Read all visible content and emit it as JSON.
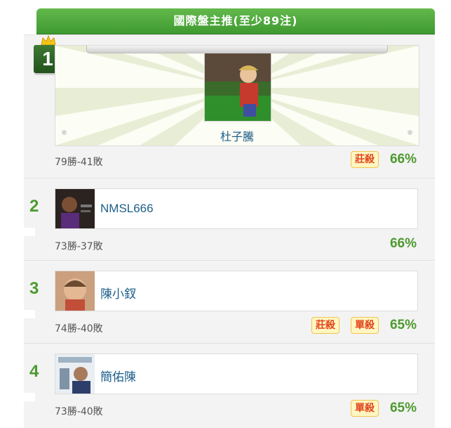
{
  "header": {
    "title": "國際盤主推(至少89注)"
  },
  "ranking": [
    {
      "rank": "1",
      "name": "杜子騰",
      "record": "79勝-41敗",
      "badges": [
        "莊殺"
      ],
      "percent": "66%"
    },
    {
      "rank": "2",
      "name": "NMSL666",
      "record": "73勝-37敗",
      "badges": [],
      "percent": "66%"
    },
    {
      "rank": "3",
      "name": "陳小釵",
      "record": "74勝-40敗",
      "badges": [
        "莊殺",
        "單殺"
      ],
      "percent": "65%"
    },
    {
      "rank": "4",
      "name": "簡佑陳",
      "record": "73勝-40敗",
      "badges": [
        "單殺"
      ],
      "percent": "65%"
    }
  ],
  "colors": {
    "header_green": "#4aa838",
    "rank_green": "#4d9a30",
    "badge_bg": "#fff6c2",
    "badge_text": "#e2461c",
    "name_blue": "#1d5f8a"
  },
  "icons": [
    "crown-icon"
  ]
}
